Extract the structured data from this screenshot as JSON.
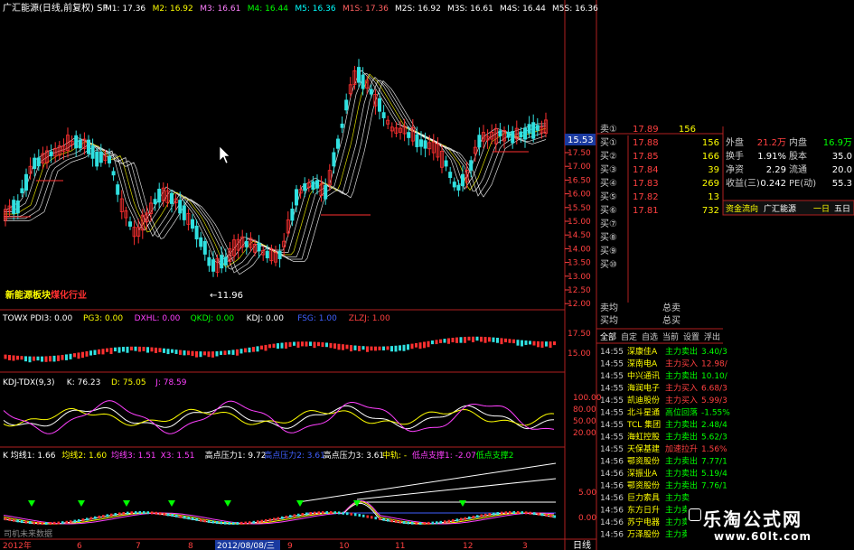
{
  "header": {
    "title": "广汇能源(日线,前复权) SF",
    "ma": [
      {
        "label": "M1: 17.36",
        "color": "#ffffff"
      },
      {
        "label": "M2: 16.92",
        "color": "#ffff00"
      },
      {
        "label": "M3: 16.61",
        "color": "#ff80ff"
      },
      {
        "label": "M4: 16.44",
        "color": "#00ff00"
      },
      {
        "label": "M5: 16.36",
        "color": "#00ffff"
      },
      {
        "label": "M1S: 17.36",
        "color": "#ff6060"
      },
      {
        "label": "M2S: 16.92",
        "color": "#ffffff"
      },
      {
        "label": "M3S: 16.61",
        "color": "#ffffff"
      },
      {
        "label": "M4S: 16.44",
        "color": "#ffffff"
      },
      {
        "label": "M5S: 16.36",
        "color": "#ffffff"
      }
    ]
  },
  "main_chart": {
    "low_label": "11.96",
    "price_tag": "15.53",
    "badges": [
      "新能源板块",
      "煤化行业"
    ],
    "yaxis": [
      "17.50",
      "17.00",
      "16.50",
      "16.00",
      "15.50",
      "15.00",
      "14.50",
      "14.00",
      "13.50",
      "13.00",
      "12.50",
      "12.00"
    ]
  },
  "indicator1": {
    "labels": [
      {
        "text": "TOWX PDI3: 0.00",
        "color": "#ffffff"
      },
      {
        "text": "PG3: 0.00",
        "color": "#ffff00"
      },
      {
        "text": "DXHL: 0.00",
        "color": "#ff40ff"
      },
      {
        "text": "QKDJ: 0.00",
        "color": "#00ff00"
      },
      {
        "text": "KDJ: 0.00",
        "color": "#ffffff"
      },
      {
        "text": "FSG: 1.00",
        "color": "#4060ff"
      },
      {
        "text": "ZLZJ: 1.00",
        "color": "#ff4040"
      }
    ],
    "yaxis": [
      "17.50",
      "15.00"
    ]
  },
  "indicator2": {
    "labels": [
      {
        "text": "KDJ-TDX(9,3)",
        "color": "#ffffff"
      },
      {
        "text": "K: 76.23",
        "color": "#ffffff"
      },
      {
        "text": "D: 75.05",
        "color": "#ffff00"
      },
      {
        "text": "J: 78.59",
        "color": "#ff40ff"
      }
    ],
    "yaxis": [
      "100.00",
      "80.00",
      "50.00",
      "20.00"
    ]
  },
  "indicator3": {
    "labels": [
      {
        "text": "K 均线1: 1.66",
        "color": "#ffffff"
      },
      {
        "text": "均线2: 1.60",
        "color": "#ffff00"
      },
      {
        "text": "均线3: 1.51",
        "color": "#ff40ff"
      },
      {
        "text": "X3: 1.51",
        "color": "#ff40ff"
      },
      {
        "text": "高点压力1: 9.72",
        "color": "#ffffff"
      },
      {
        "text": "高点压力2: 3.61",
        "color": "#4060ff"
      },
      {
        "text": "高点压力3: 3.61",
        "color": "#ffffff"
      },
      {
        "text": "中轨: -",
        "color": "#ffff00"
      },
      {
        "text": "低点支撑1: -2.07",
        "color": "#ff40ff"
      },
      {
        "text": "低点支撑2",
        "color": "#00ff00"
      }
    ],
    "yaxis": [
      "5.00",
      "0.00"
    ],
    "corner_note": "司机未来数据"
  },
  "xaxis": {
    "labels": [
      {
        "text": "2012年",
        "color": "#ff4040"
      },
      {
        "text": "6",
        "color": "#ff4040"
      },
      {
        "text": "7",
        "color": "#ff4040"
      },
      {
        "text": "8",
        "color": "#ff4040"
      },
      {
        "text": "2012/08/08/三",
        "color": "#ffffff"
      },
      {
        "text": "9",
        "color": "#ff4040"
      },
      {
        "text": "10",
        "color": "#ff4040"
      },
      {
        "text": "11",
        "color": "#ff4040"
      },
      {
        "text": "12",
        "color": "#ff4040"
      },
      {
        "text": "3",
        "color": "#ff4040"
      }
    ],
    "period": "日线"
  },
  "right_panel": {
    "top_rows": [
      {
        "label": "卖①",
        "price": "17.89",
        "vol": "156"
      }
    ],
    "buy_rows": [
      {
        "label": "买①",
        "price": "17.88",
        "vol": "156"
      },
      {
        "label": "买②",
        "price": "17.85",
        "vol": "166"
      },
      {
        "label": "买③",
        "price": "17.84",
        "vol": "39"
      },
      {
        "label": "买④",
        "price": "17.83",
        "vol": "269"
      },
      {
        "label": "买⑤",
        "price": "17.82",
        "vol": "13"
      },
      {
        "label": "买⑥",
        "price": "17.81",
        "vol": "732"
      },
      {
        "label": "买⑦",
        "price": "",
        "vol": ""
      },
      {
        "label": "买⑧",
        "price": "",
        "vol": ""
      },
      {
        "label": "买⑨",
        "price": "",
        "vol": ""
      },
      {
        "label": "买⑩",
        "price": "",
        "vol": ""
      }
    ],
    "stats": [
      {
        "l1": "外盘",
        "v1": "21.2万",
        "l2": "内盘",
        "v2": "16.9万"
      },
      {
        "l1": "换手",
        "v1": "1.91%",
        "l2": "股本",
        "v2": "35.0"
      },
      {
        "l1": "净资",
        "v1": "2.29",
        "l2": "流通",
        "v2": "20.0"
      },
      {
        "l1": "收益(三)",
        "v1": "0.242",
        "l2": "PE(动)",
        "v2": "55.3"
      }
    ],
    "capital_flow": {
      "label": "资金流向",
      "name": "广汇能源",
      "t1": "一日",
      "t2": "五日"
    },
    "avg": [
      {
        "l": "卖均",
        "r": "总卖"
      },
      {
        "l": "买均",
        "r": "总买"
      }
    ],
    "tabs": [
      "全部",
      "自定",
      "自选",
      "当前",
      "设置",
      "浮出"
    ],
    "ticks": [
      {
        "time": "14:55",
        "name": "深康佳A",
        "act": "主力卖出",
        "val": "3.40/3",
        "color": "#00ff00"
      },
      {
        "time": "14:55",
        "name": "深南电A",
        "act": "主力买入",
        "val": "12.98/",
        "color": "#ff4040"
      },
      {
        "time": "14:55",
        "name": "中兴通讯",
        "act": "主力卖出",
        "val": "10.10/",
        "color": "#00ff00"
      },
      {
        "time": "14:55",
        "name": "海润电子",
        "act": "主力买入",
        "val": "6.68/3",
        "color": "#ff4040"
      },
      {
        "time": "14:55",
        "name": "凯迪股份",
        "act": "主力买入",
        "val": "5.99/3",
        "color": "#ff4040"
      },
      {
        "time": "14:55",
        "name": "北斗星通",
        "act": "高位回落",
        "val": "-1.55%",
        "color": "#00ff00"
      },
      {
        "time": "14:55",
        "name": "TCL 集团",
        "act": "主力卖出",
        "val": "2.48/4",
        "color": "#00ff00"
      },
      {
        "time": "14:55",
        "name": "海虹控股",
        "act": "主力卖出",
        "val": "5.62/3",
        "color": "#00ff00"
      },
      {
        "time": "14:55",
        "name": "天保基建",
        "act": "加速拉升",
        "val": "1.56%",
        "color": "#ff4040"
      },
      {
        "time": "14:56",
        "name": "鄂资股份",
        "act": "主力卖出",
        "val": "7.77/1",
        "color": "#00ff00"
      },
      {
        "time": "14:56",
        "name": "深振业A",
        "act": "主力卖出",
        "val": "5.19/4",
        "color": "#00ff00"
      },
      {
        "time": "14:56",
        "name": "鄂资股份",
        "act": "主力卖出",
        "val": "7.76/1",
        "color": "#00ff00"
      },
      {
        "time": "14:56",
        "name": "巨力索具",
        "act": "主力卖",
        "val": "",
        "color": "#00ff00"
      },
      {
        "time": "14:56",
        "name": "东方日升",
        "act": "主力卖",
        "val": "",
        "color": "#00ff00"
      },
      {
        "time": "14:56",
        "name": "苏宁电器",
        "act": "主力卖",
        "val": "",
        "color": "#00ff00"
      },
      {
        "time": "14:56",
        "name": "万泽股份",
        "act": "主力卖",
        "val": "",
        "color": "#00ff00"
      }
    ]
  },
  "watermark": {
    "line1": "乐淘公式网",
    "line2": "www.60lt.com"
  },
  "colors": {
    "up": "#ff3030",
    "down": "#30e0e0",
    "border": "#b02020",
    "bg": "#000000"
  }
}
